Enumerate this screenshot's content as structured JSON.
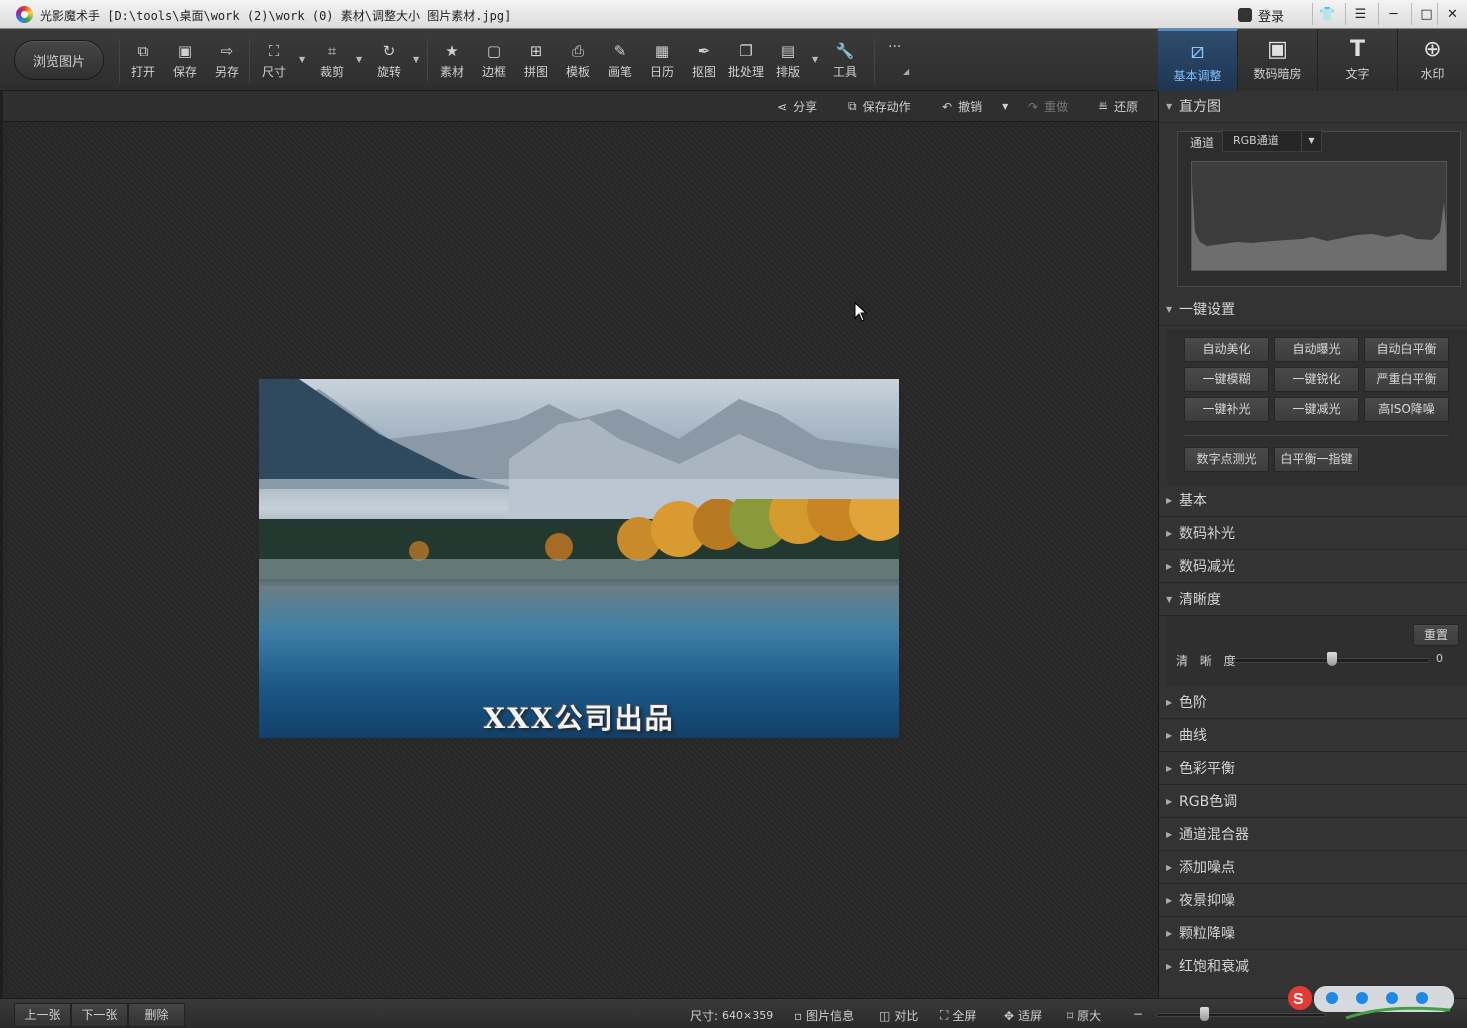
{
  "window": {
    "title": "光影魔术手  [D:\\tools\\桌面\\work (2)\\work (0) 素材\\调整大小 图片素材.jpg]",
    "login": "登录",
    "controls": [
      "shirt-icon",
      "menu-icon",
      "minimize-icon",
      "maximize-icon",
      "close-icon"
    ]
  },
  "toolbar": {
    "browse": "浏览图片",
    "tools": [
      {
        "label": "打开",
        "icon": "open-icon"
      },
      {
        "label": "保存",
        "icon": "save-icon"
      },
      {
        "label": "另存",
        "icon": "save-as-icon"
      },
      {
        "label": "尺寸",
        "icon": "resize-icon"
      },
      {
        "label": "裁剪",
        "icon": "crop-icon"
      },
      {
        "label": "旋转",
        "icon": "rotate-icon"
      },
      {
        "label": "素材",
        "icon": "material-icon"
      },
      {
        "label": "边框",
        "icon": "frame-icon"
      },
      {
        "label": "拼图",
        "icon": "collage-icon"
      },
      {
        "label": "模板",
        "icon": "template-icon"
      },
      {
        "label": "画笔",
        "icon": "brush-icon"
      },
      {
        "label": "日历",
        "icon": "calendar-icon"
      },
      {
        "label": "抠图",
        "icon": "cutout-icon"
      },
      {
        "label": "批处理",
        "icon": "batch-icon"
      },
      {
        "label": "排版",
        "icon": "layout-icon"
      },
      {
        "label": "工具",
        "icon": "wrench-icon"
      }
    ],
    "more": "···"
  },
  "right_tabs": [
    {
      "label": "基本调整",
      "icon": "adjust-icon",
      "active": true
    },
    {
      "label": "数码暗房",
      "icon": "camera-icon",
      "active": false
    },
    {
      "label": "文字",
      "icon": "text-icon",
      "active": false
    },
    {
      "label": "水印",
      "icon": "watermark-icon",
      "active": false
    }
  ],
  "actions": {
    "share": "分享",
    "save_action": "保存动作",
    "undo": "撤销",
    "redo": "重做",
    "restore": "还原"
  },
  "image": {
    "watermark_text": "XXX公司出品"
  },
  "panel": {
    "histogram": {
      "title": "直方图",
      "channel_label": "通道",
      "channel_value": "RGB通道"
    },
    "onekey": {
      "title": "一键设置",
      "buttons": [
        "自动美化",
        "自动曝光",
        "自动白平衡",
        "一键模糊",
        "一键锐化",
        "严重白平衡",
        "一键补光",
        "一键减光",
        "高ISO降噪"
      ],
      "extra_buttons": [
        "数字点测光",
        "白平衡一指键"
      ]
    },
    "sections_a": [
      "基本",
      "数码补光",
      "数码减光"
    ],
    "clarity": {
      "title": "清晰度",
      "reset": "重置",
      "label": "清 晰 度",
      "value": "0",
      "level": 0.5
    },
    "sections_b": [
      "色阶",
      "曲线",
      "色彩平衡",
      "RGB色调",
      "通道混合器",
      "添加噪点",
      "夜景抑噪",
      "颗粒降噪",
      "红饱和衰减"
    ]
  },
  "status": {
    "prev": "上一张",
    "next": "下一张",
    "delete": "删除",
    "size_label": "尺寸:",
    "size_value": "640×359",
    "info": "图片信息",
    "compare": "对比",
    "fullscreen": "全屏",
    "fit": "适屏",
    "original": "原大",
    "zoom_minus": "−",
    "zoom_level": 0.28
  },
  "colors": {
    "accent": "#4a8fd4",
    "panel_bg": "#333333",
    "canvas_bg": "#262626"
  }
}
